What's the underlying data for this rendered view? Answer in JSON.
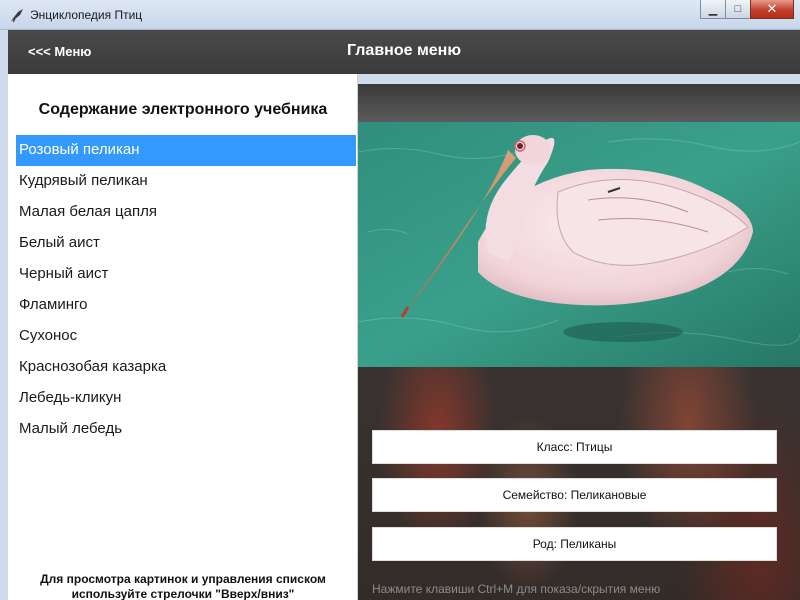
{
  "window": {
    "title": "Энциклопедия Птиц",
    "controls": {
      "minimize": "▁",
      "maximize": "□",
      "close": "✕"
    }
  },
  "header": {
    "back_label": "<<< Меню",
    "title": "Главное меню"
  },
  "sidebar": {
    "title": "Содержание электронного учебника",
    "items": [
      {
        "label": "Розовый пеликан",
        "selected": true
      },
      {
        "label": "Кудрявый пеликан"
      },
      {
        "label": "Малая белая цапля"
      },
      {
        "label": "Белый аист"
      },
      {
        "label": "Черный аист"
      },
      {
        "label": "Фламинго"
      },
      {
        "label": "Сухонос"
      },
      {
        "label": "Краснозобая казарка"
      },
      {
        "label": "Лебедь-кликун"
      },
      {
        "label": "Малый лебедь"
      }
    ],
    "hint": "Для просмотра картинок и управления списком используйте стрелочки \"Вверх/вниз\""
  },
  "details": {
    "image_icon": "pink-pelican-photo",
    "class": "Класс: Птицы",
    "family": "Семейство: Пеликановые",
    "genus": "Род: Пеликаны",
    "hint": "Нажмите клавиши Ctrl+M для показа/скрытия меню"
  },
  "colors": {
    "selection": "#3399ff",
    "header": "#404040",
    "water": "#2f8f7c"
  }
}
